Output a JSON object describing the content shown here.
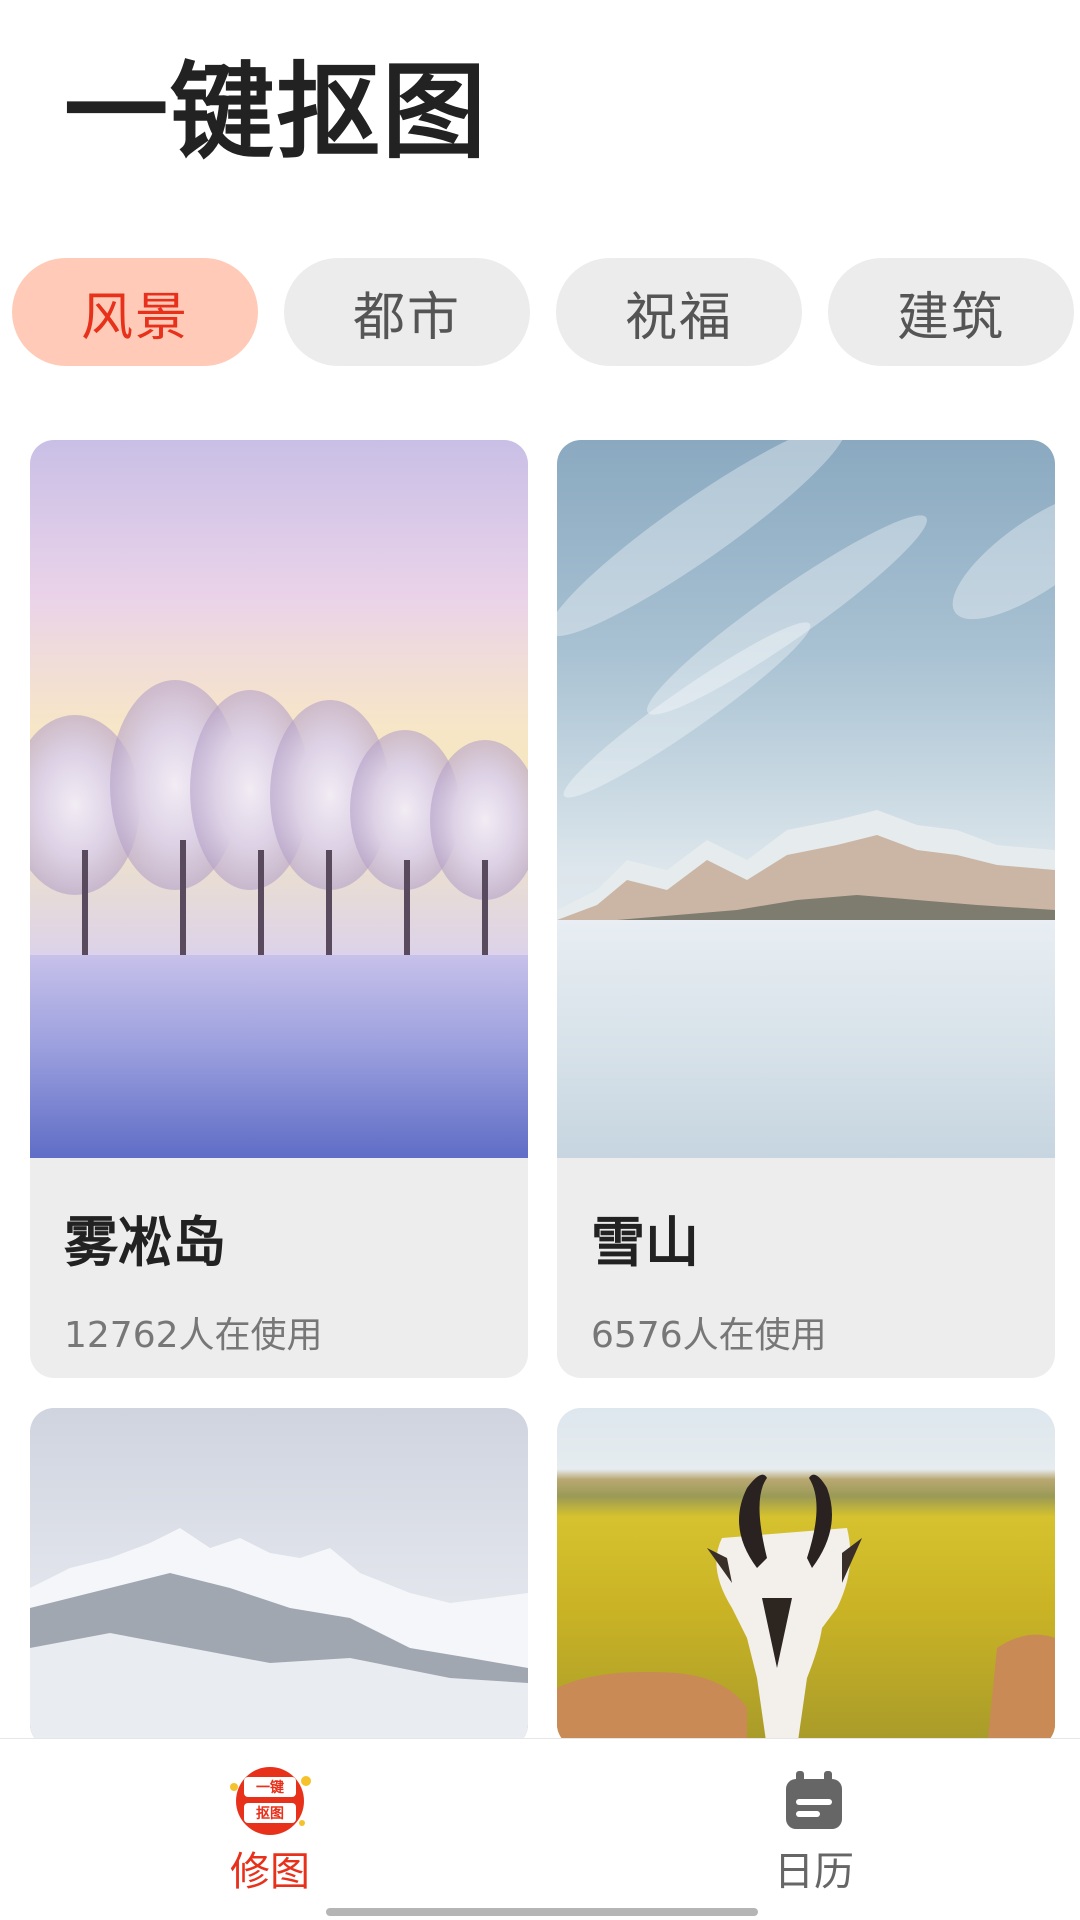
{
  "header": {
    "title": "一键抠图"
  },
  "tabs": [
    {
      "label": "风景",
      "active": true
    },
    {
      "label": "都市",
      "active": false
    },
    {
      "label": "祝福",
      "active": false
    },
    {
      "label": "建筑",
      "active": false
    }
  ],
  "cards": [
    {
      "name": "雾凇岛",
      "users": "12762人在使用"
    },
    {
      "name": "雪山",
      "users": "6576人在使用"
    }
  ],
  "bottom_nav": {
    "items": [
      {
        "label": "修图",
        "icon": "cutout-logo-icon",
        "active": true,
        "badge_text": "一键抠图"
      },
      {
        "label": "日历",
        "icon": "calendar-icon",
        "active": false
      }
    ]
  },
  "colors": {
    "accent": "#e8311b",
    "active_tab_bg": "#ffcbb8",
    "tab_bg": "#ececec",
    "card_bg": "#ededed"
  }
}
